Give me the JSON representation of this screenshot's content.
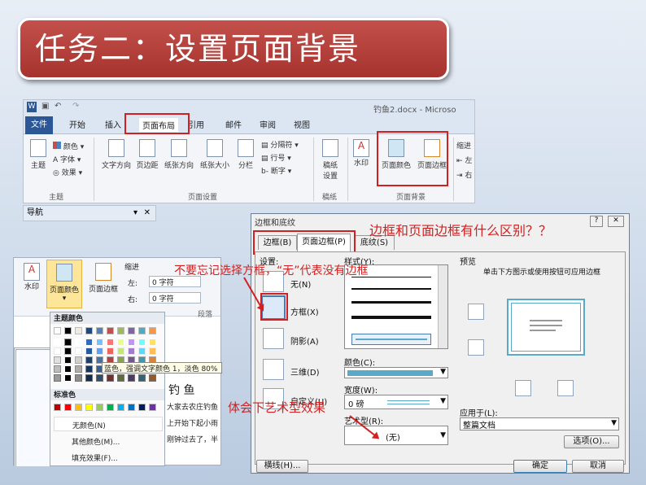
{
  "slide_title": "任务二：设置页面背景",
  "ribbon": {
    "doc_title": "钓鱼2.docx - Microso",
    "tabs": [
      "文件",
      "开始",
      "插入",
      "页面布局",
      "引用",
      "邮件",
      "审阅",
      "视图"
    ],
    "theme_group": {
      "theme": "主题",
      "colors": "颜色",
      "fonts": "字体",
      "effects": "效果",
      "label": "主题"
    },
    "page_setup": {
      "items": [
        "文字方向",
        "页边距",
        "纸张方向",
        "纸张大小",
        "分栏"
      ],
      "breaks": "分隔符",
      "line_numbers": "行号",
      "hyphen": "断字",
      "label": "页面设置"
    },
    "draft": {
      "item": "稿纸设置",
      "label": "稿纸"
    },
    "background": {
      "watermark": "水印",
      "page_color": "页面颜色",
      "page_border": "页面边框",
      "label": "页面背景"
    },
    "indent": "缩进",
    "indent_left": "左",
    "indent_right": "右"
  },
  "nav_pane": "导航",
  "color_panel": {
    "ribbon_items": [
      "水印",
      "页面颜色",
      "页面边框"
    ],
    "indent": "缩进",
    "left_label": "左:",
    "left_value": "0 字符",
    "right_label": "右:",
    "right_value": "0 字符",
    "para": "段落",
    "theme_colors": "主题颜色",
    "tooltip": "蓝色，强调文字颜色 1，淡色 80%",
    "standard_colors": "标准色",
    "no_color": "无颜色(N)",
    "more_colors": "其他颜色(M)...",
    "fill_effects": "填充效果(F)...",
    "doc_lines": [
      "钓  鱼",
      "大家去农庄钓鱼",
      "上开始下起小雨",
      "刚钟过去了，半"
    ]
  },
  "dialog": {
    "title": "边框和底纹",
    "tabs": [
      "边框(B)",
      "页面边框(P)",
      "底纹(S)"
    ],
    "setting_label": "设置:",
    "settings": [
      "无(N)",
      "方框(X)",
      "阴影(A)",
      "三维(D)",
      "自定义(U)"
    ],
    "style_label": "样式(Y):",
    "color_label": "颜色(C):",
    "width_label": "宽度(W):",
    "width_value": "0 磅",
    "art_label": "艺术型(R):",
    "art_value": "(无)",
    "preview_label": "预览",
    "preview_hint": "单击下方图示或使用按钮可应用边框",
    "apply_label": "应用于(L):",
    "apply_value": "整篇文档",
    "options": "选项(O)...",
    "hline": "横线(H)...",
    "ok": "确定",
    "cancel": "取消"
  },
  "annotations": {
    "q": "边框和页面边框有什么区别？？",
    "note1": "不要忘记选择方框，“无”代表没有边框",
    "note2": "体会下艺术型效果"
  },
  "colors": {
    "accent_red": "#d42020",
    "title_bg": "#b3403b",
    "selected_blue": "#5aa9c8"
  }
}
